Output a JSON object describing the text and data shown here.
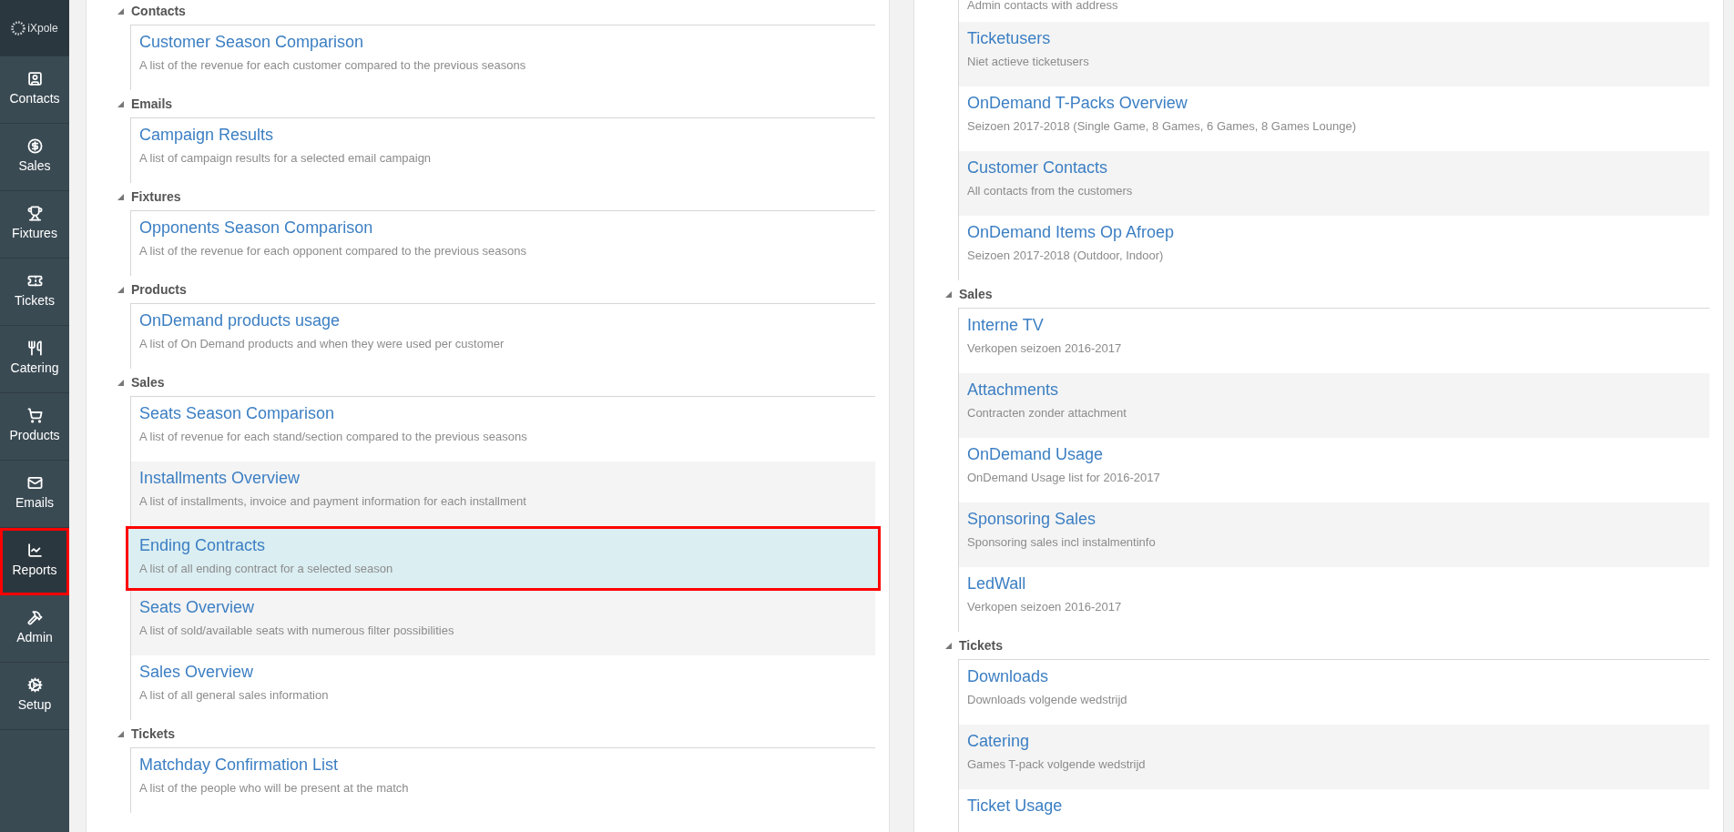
{
  "sidebar": {
    "logo": "iXpole",
    "items": [
      {
        "kind": "contacts",
        "label": "Contacts",
        "selected": false,
        "highlighted": false
      },
      {
        "kind": "sales",
        "label": "Sales",
        "selected": false,
        "highlighted": false
      },
      {
        "kind": "fixtures",
        "label": "Fixtures",
        "selected": false,
        "highlighted": false
      },
      {
        "kind": "tickets",
        "label": "Tickets",
        "selected": false,
        "highlighted": false
      },
      {
        "kind": "catering",
        "label": "Catering",
        "selected": false,
        "highlighted": false
      },
      {
        "kind": "products",
        "label": "Products",
        "selected": false,
        "highlighted": false
      },
      {
        "kind": "emails",
        "label": "Emails",
        "selected": false,
        "highlighted": false
      },
      {
        "kind": "reports",
        "label": "Reports",
        "selected": true,
        "highlighted": true
      },
      {
        "kind": "admin",
        "label": "Admin",
        "selected": false,
        "highlighted": false
      },
      {
        "kind": "setup",
        "label": "Setup",
        "selected": false,
        "highlighted": false
      }
    ]
  },
  "left_column": {
    "sections": [
      {
        "title": "Contacts",
        "reports": [
          {
            "title": "Customer Season Comparison",
            "description": "A list of the revenue for each customer compared to the previous seasons",
            "selected": false,
            "highlighted": false
          }
        ]
      },
      {
        "title": "Emails",
        "reports": [
          {
            "title": "Campaign Results",
            "description": "A list of campaign results for a selected email campaign",
            "selected": false,
            "highlighted": false
          }
        ]
      },
      {
        "title": "Fixtures",
        "reports": [
          {
            "title": "Opponents Season Comparison",
            "description": "A list of the revenue for each opponent compared to the previous seasons",
            "selected": false,
            "highlighted": false
          }
        ]
      },
      {
        "title": "Products",
        "reports": [
          {
            "title": "OnDemand products usage",
            "description": "A list of On Demand products and when they were used per customer",
            "selected": false,
            "highlighted": false
          }
        ]
      },
      {
        "title": "Sales",
        "reports": [
          {
            "title": "Seats Season Comparison",
            "description": "A list of revenue for each stand/section compared to the previous seasons",
            "selected": false,
            "highlighted": false
          },
          {
            "title": "Installments Overview",
            "description": "A list of installments, invoice and payment information for each installment",
            "selected": false,
            "highlighted": false
          },
          {
            "title": "Ending Contracts",
            "description": "A list of all ending contract for a selected season",
            "selected": true,
            "highlighted": true
          },
          {
            "title": "Seats Overview",
            "description": "A list of sold/available seats with numerous filter possibilities",
            "selected": false,
            "highlighted": false
          },
          {
            "title": "Sales Overview",
            "description": "A list of all general sales information",
            "selected": false,
            "highlighted": false
          }
        ]
      },
      {
        "title": "Tickets",
        "reports": [
          {
            "title": "Matchday Confirmation List",
            "description": "A list of the people who will be present at the match",
            "selected": false,
            "highlighted": false
          }
        ]
      }
    ]
  },
  "right_column": {
    "sections": [
      {
        "reports": [
          {
            "description": "Admin contacts with address",
            "selected": false,
            "highlighted": false
          },
          {
            "title": "Ticketusers",
            "description": "Niet actieve ticketusers",
            "selected": false,
            "highlighted": false
          },
          {
            "title": "OnDemand T-Packs Overview",
            "description": "Seizoen 2017-2018 (Single Game, 8 Games, 6 Games, 8 Games Lounge)",
            "selected": false,
            "highlighted": false
          },
          {
            "title": "Customer Contacts",
            "description": "All contacts from the customers",
            "selected": false,
            "highlighted": false
          },
          {
            "title": "OnDemand Items Op Afroep",
            "description": "Seizoen 2017-2018 (Outdoor, Indoor)",
            "selected": false,
            "highlighted": false
          }
        ]
      },
      {
        "title": "Sales",
        "reports": [
          {
            "title": "Interne TV",
            "description": "Verkopen seizoen 2016-2017",
            "selected": false,
            "highlighted": false
          },
          {
            "title": "Attachments",
            "description": "Contracten zonder attachment",
            "selected": false,
            "highlighted": false
          },
          {
            "title": "OnDemand Usage",
            "description": "OnDemand Usage list for 2016-2017",
            "selected": false,
            "highlighted": false
          },
          {
            "title": "Sponsoring Sales",
            "description": "Sponsoring sales incl instalmentinfo",
            "selected": false,
            "highlighted": false
          },
          {
            "title": "LedWall",
            "description": "Verkopen seizoen 2016-2017",
            "selected": false,
            "highlighted": false
          }
        ]
      },
      {
        "title": "Tickets",
        "reports": [
          {
            "title": "Downloads",
            "description": "Downloads volgende wedstrijd",
            "selected": false,
            "highlighted": false
          },
          {
            "title": "Catering",
            "description": "Games T-pack volgende wedstrijd",
            "selected": false,
            "highlighted": false
          },
          {
            "title": "Ticket Usage",
            "selected": false,
            "highlighted": false
          }
        ]
      }
    ]
  }
}
